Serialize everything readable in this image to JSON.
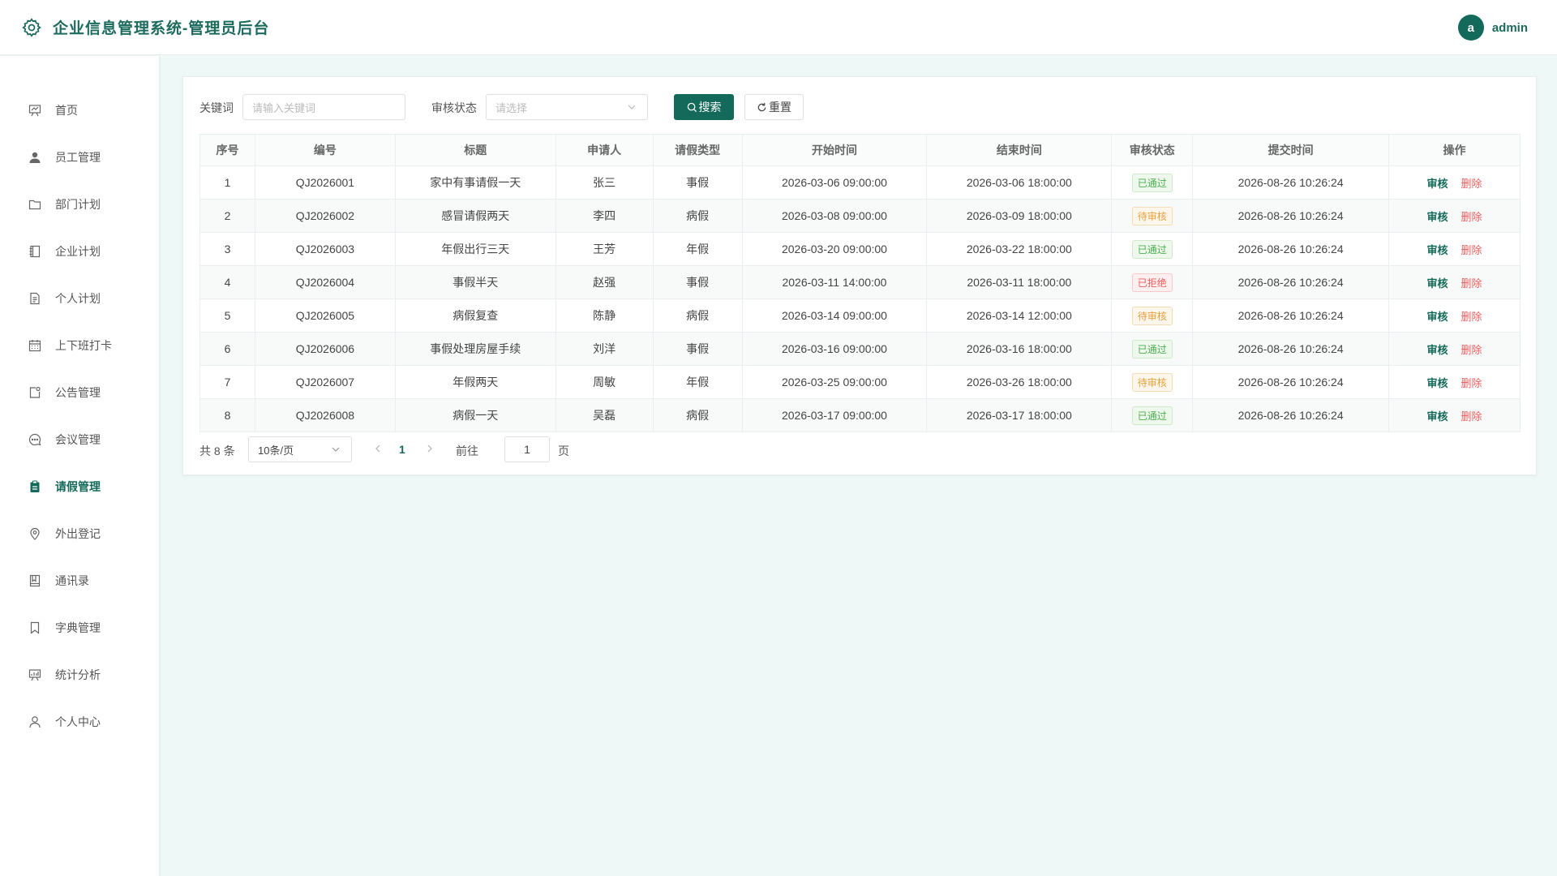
{
  "header": {
    "title": "企业信息管理系统-管理员后台",
    "avatar_letter": "a",
    "username": "admin"
  },
  "sidebar": {
    "items": [
      {
        "label": "首页",
        "icon": "dashboard-icon",
        "active": false
      },
      {
        "label": "员工管理",
        "icon": "user-filled-icon",
        "active": false
      },
      {
        "label": "部门计划",
        "icon": "folder-icon",
        "active": false
      },
      {
        "label": "企业计划",
        "icon": "notebook-icon",
        "active": false
      },
      {
        "label": "个人计划",
        "icon": "document-icon",
        "active": false
      },
      {
        "label": "上下班打卡",
        "icon": "calendar-icon",
        "active": false
      },
      {
        "label": "公告管理",
        "icon": "notice-icon",
        "active": false
      },
      {
        "label": "会议管理",
        "icon": "chat-icon",
        "active": false
      },
      {
        "label": "请假管理",
        "icon": "clipboard-icon",
        "active": true
      },
      {
        "label": "外出登记",
        "icon": "location-icon",
        "active": false
      },
      {
        "label": "通讯录",
        "icon": "contacts-book-icon",
        "active": false
      },
      {
        "label": "字典管理",
        "icon": "bookmark-icon",
        "active": false
      },
      {
        "label": "统计分析",
        "icon": "chart-board-icon",
        "active": false
      },
      {
        "label": "个人中心",
        "icon": "person-icon",
        "active": false
      }
    ]
  },
  "filter": {
    "keyword_label": "关键词",
    "keyword_placeholder": "请输入关键词",
    "status_label": "审核状态",
    "status_placeholder": "请选择",
    "search_label": "搜索",
    "reset_label": "重置"
  },
  "table": {
    "headers": [
      "序号",
      "编号",
      "标题",
      "申请人",
      "请假类型",
      "开始时间",
      "结束时间",
      "审核状态",
      "提交时间",
      "操作"
    ],
    "audit_label": "审核",
    "delete_label": "删除",
    "rows": [
      {
        "index": "1",
        "code": "QJ2026001",
        "title": "家中有事请假一天",
        "applicant": "张三",
        "type": "事假",
        "start": "2026-03-06 09:00:00",
        "end": "2026-03-06 18:00:00",
        "status": "已通过",
        "status_color": "green",
        "submitted": "2026-08-26 10:26:24"
      },
      {
        "index": "2",
        "code": "QJ2026002",
        "title": "感冒请假两天",
        "applicant": "李四",
        "type": "病假",
        "start": "2026-03-08 09:00:00",
        "end": "2026-03-09 18:00:00",
        "status": "待审核",
        "status_color": "orange",
        "submitted": "2026-08-26 10:26:24"
      },
      {
        "index": "3",
        "code": "QJ2026003",
        "title": "年假出行三天",
        "applicant": "王芳",
        "type": "年假",
        "start": "2026-03-20 09:00:00",
        "end": "2026-03-22 18:00:00",
        "status": "已通过",
        "status_color": "green",
        "submitted": "2026-08-26 10:26:24"
      },
      {
        "index": "4",
        "code": "QJ2026004",
        "title": "事假半天",
        "applicant": "赵强",
        "type": "事假",
        "start": "2026-03-11 14:00:00",
        "end": "2026-03-11 18:00:00",
        "status": "已拒绝",
        "status_color": "red",
        "submitted": "2026-08-26 10:26:24"
      },
      {
        "index": "5",
        "code": "QJ2026005",
        "title": "病假复查",
        "applicant": "陈静",
        "type": "病假",
        "start": "2026-03-14 09:00:00",
        "end": "2026-03-14 12:00:00",
        "status": "待审核",
        "status_color": "orange",
        "submitted": "2026-08-26 10:26:24"
      },
      {
        "index": "6",
        "code": "QJ2026006",
        "title": "事假处理房屋手续",
        "applicant": "刘洋",
        "type": "事假",
        "start": "2026-03-16 09:00:00",
        "end": "2026-03-16 18:00:00",
        "status": "已通过",
        "status_color": "green",
        "submitted": "2026-08-26 10:26:24"
      },
      {
        "index": "7",
        "code": "QJ2026007",
        "title": "年假两天",
        "applicant": "周敏",
        "type": "年假",
        "start": "2026-03-25 09:00:00",
        "end": "2026-03-26 18:00:00",
        "status": "待审核",
        "status_color": "orange",
        "submitted": "2026-08-26 10:26:24"
      },
      {
        "index": "8",
        "code": "QJ2026008",
        "title": "病假一天",
        "applicant": "吴磊",
        "type": "病假",
        "start": "2026-03-17 09:00:00",
        "end": "2026-03-17 18:00:00",
        "status": "已通过",
        "status_color": "green",
        "submitted": "2026-08-26 10:26:24"
      }
    ]
  },
  "pagination": {
    "total_text": "共 8 条",
    "page_size": "10条/页",
    "current_page": "1",
    "goto_label": "前往",
    "goto_value": "1",
    "page_suffix": "页"
  },
  "colors": {
    "primary": "#146a5a",
    "background": "#eef8f6",
    "success": "#4caf50",
    "warning": "#e6a23c",
    "danger": "#f05c5c"
  }
}
